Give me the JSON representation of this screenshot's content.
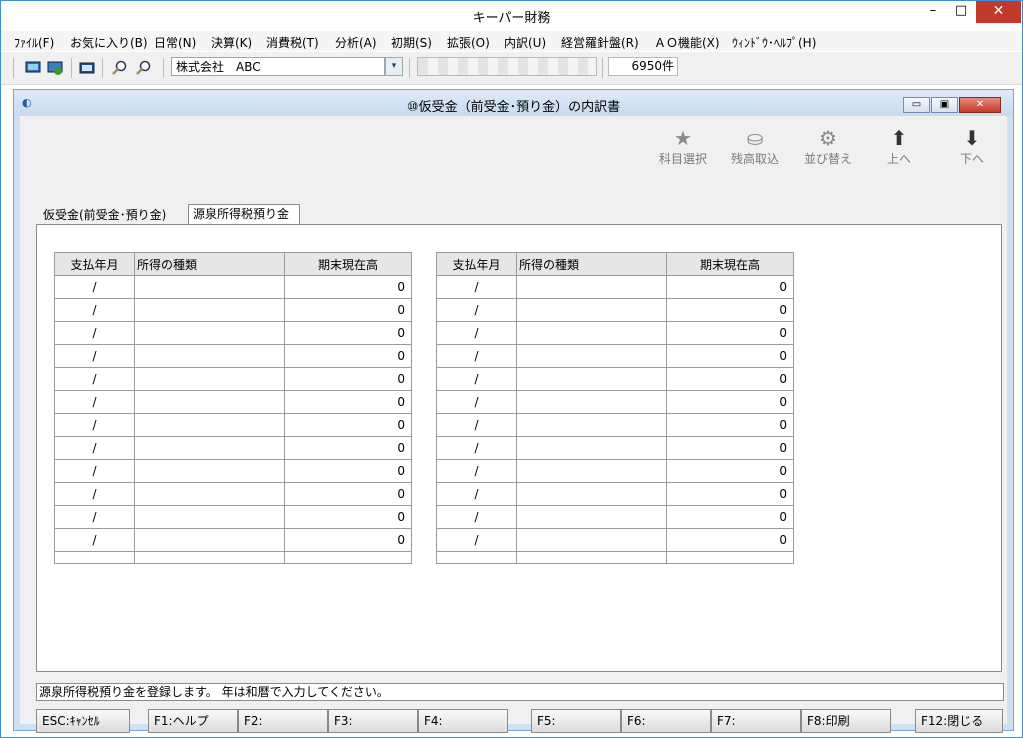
{
  "window": {
    "title": "キーパー財務",
    "min": "–",
    "max": "□",
    "close": "✕"
  },
  "menu": [
    "ﾌｧｲﾙ(F)",
    "お気に入り(B)",
    "日常(N)",
    "決算(K)",
    "消費税(T)",
    "分析(A)",
    "初期(S)",
    "拡張(O)",
    "内訳(U)",
    "経営羅針盤(R)",
    "ＡＯ機能(X)",
    "ｳｨﾝﾄﾞｳ･ﾍﾙﾌﾟ(H)"
  ],
  "toolbar": {
    "company": "株式会社　ABC",
    "count": "6950件",
    "combo_arrow": "▾"
  },
  "child": {
    "title": "⑩仮受金（前受金･預り金）の内訳書",
    "icon": "◐",
    "min": "▭",
    "max": "▣",
    "close": "✕",
    "tools": [
      {
        "label": "科目選択",
        "icon": "star-icon",
        "glyph": "★"
      },
      {
        "label": "残高取込",
        "icon": "import-icon",
        "glyph": "⛀"
      },
      {
        "label": "並び替え",
        "icon": "sort-icon",
        "glyph": "⚙"
      },
      {
        "label": "上へ",
        "icon": "arrow-up-icon",
        "glyph": "⬆"
      },
      {
        "label": "下へ",
        "icon": "arrow-down-icon",
        "glyph": "⬇"
      }
    ],
    "tabs": [
      "仮受金(前受金･預り金)",
      "源泉所得税預り金"
    ],
    "table": {
      "headers": [
        "支払年月",
        "所得の種類",
        "期末現在高"
      ],
      "row_date": "/",
      "row_value": "0"
    },
    "status": "源泉所得税預り金を登録します。 年は和暦で入力してください。",
    "fkeys": [
      "ESC:ｷｬﾝｾﾙ",
      "F1:ヘルプ",
      "F2:",
      "F3:",
      "F4:",
      "F5:",
      "F6:",
      "F7:",
      "F8:印刷",
      "F12:閉じる"
    ]
  }
}
